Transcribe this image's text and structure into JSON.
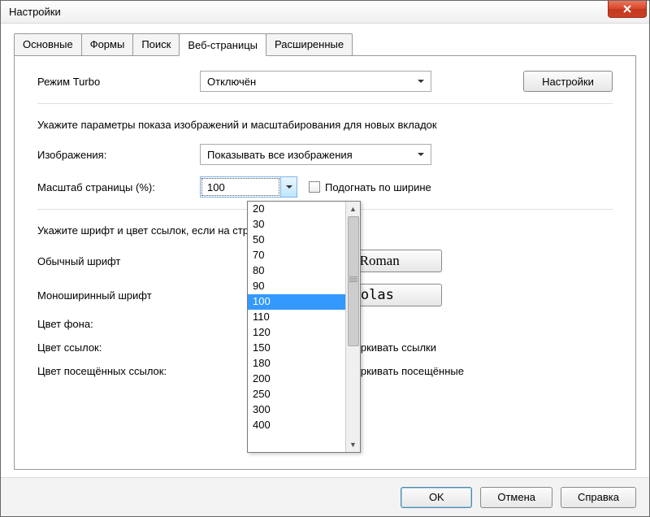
{
  "window": {
    "title": "Настройки"
  },
  "tabs": [
    {
      "label": "Основные"
    },
    {
      "label": "Формы"
    },
    {
      "label": "Поиск"
    },
    {
      "label": "Веб-страницы",
      "active": true
    },
    {
      "label": "Расширенные"
    }
  ],
  "turbo": {
    "label": "Режим Turbo",
    "value": "Отключён",
    "settings_btn": "Настройки"
  },
  "images_desc": "Укажите параметры показа изображений и масштабирования для новых вкладок",
  "images": {
    "label": "Изображения:",
    "value": "Показывать все изображения"
  },
  "zoom": {
    "label": "Масштаб страницы (%):",
    "value": "100",
    "fit_width": "Подогнать по ширине",
    "options": [
      "20",
      "30",
      "50",
      "70",
      "80",
      "90",
      "100",
      "110",
      "120",
      "150",
      "180",
      "200",
      "250",
      "300",
      "400"
    ],
    "selected": "100"
  },
  "fonts_desc": "Укажите шрифт и цвет ссылок, если на странице не указан стиль",
  "normal_font": {
    "label": "Обычный шрифт",
    "value": "Times New Roman",
    "partial": "New Roman"
  },
  "mono_font": {
    "label": "Моноширинный шрифт",
    "value": "Consolas",
    "partial": "onsolas"
  },
  "bgcolor": {
    "label": "Цвет фона:"
  },
  "linkcolor": {
    "label": "Цвет ссылок:",
    "underline": "Подчёркивать ссылки"
  },
  "visited": {
    "label": "Цвет посещённых ссылок:",
    "underline": "Подчёркивать посещённые"
  },
  "buttons": {
    "ok": "OK",
    "cancel": "Отмена",
    "help": "Справка"
  }
}
